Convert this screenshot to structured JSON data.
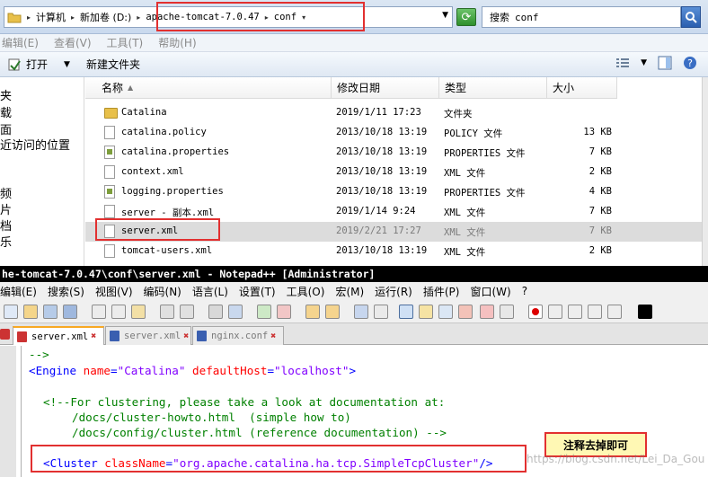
{
  "explorer": {
    "breadcrumbs": [
      "计算机",
      "新加卷 (D:)",
      "apache-tomcat-7.0.47",
      "conf"
    ],
    "search_placeholder": "搜索",
    "search_scope": "conf",
    "menu": [
      "编辑(E)",
      "查看(V)",
      "工具(T)",
      "帮助(H)"
    ],
    "toolbar": {
      "open_label": "打开",
      "new_folder_label": "新建文件夹"
    },
    "nav_items": [
      "夹",
      "载",
      "面",
      "近访问的位置",
      "频",
      "片",
      "档",
      "乐"
    ],
    "columns": {
      "name": "名称",
      "date": "修改日期",
      "type": "类型",
      "size": "大小"
    },
    "files": [
      {
        "name": "Catalina",
        "date": "2019/1/11 17:23",
        "type": "文件夹",
        "size": "",
        "icon": "folder-icon"
      },
      {
        "name": "catalina.policy",
        "date": "2013/10/18 13:19",
        "type": "POLICY 文件",
        "size": "13 KB",
        "icon": "file-icon"
      },
      {
        "name": "catalina.properties",
        "date": "2013/10/18 13:19",
        "type": "PROPERTIES 文件",
        "size": "7 KB",
        "icon": "config-file-icon"
      },
      {
        "name": "context.xml",
        "date": "2013/10/18 13:19",
        "type": "XML 文件",
        "size": "2 KB",
        "icon": "file-icon"
      },
      {
        "name": "logging.properties",
        "date": "2013/10/18 13:19",
        "type": "PROPERTIES 文件",
        "size": "4 KB",
        "icon": "config-file-icon"
      },
      {
        "name": "server - 副本.xml",
        "date": "2019/1/14 9:24",
        "type": "XML 文件",
        "size": "7 KB",
        "icon": "file-icon"
      },
      {
        "name": "server.xml",
        "date": "2019/2/21 17:27",
        "type": "XML 文件",
        "size": "7 KB",
        "icon": "file-icon"
      },
      {
        "name": "tomcat-users.xml",
        "date": "2013/10/18 13:19",
        "type": "XML 文件",
        "size": "2 KB",
        "icon": "file-icon"
      }
    ],
    "selected_file": "server.xml"
  },
  "notepad": {
    "title": "he-tomcat-7.0.47\\conf\\server.xml - Notepad++ [Administrator]",
    "menu": [
      "编辑(E)",
      "搜索(S)",
      "视图(V)",
      "编码(N)",
      "语言(L)",
      "设置(T)",
      "工具(O)",
      "宏(M)",
      "运行(R)",
      "插件(P)",
      "窗口(W)",
      "?"
    ],
    "tabs": [
      {
        "label": "server.xml",
        "active": true
      },
      {
        "label": "server.xml",
        "active": false
      },
      {
        "label": "nginx.conf",
        "active": false
      }
    ],
    "code": {
      "line1": "-->",
      "line2": {
        "tag_open": "<Engine",
        "attr1": "name",
        "val1": "\"Catalina\"",
        "attr2": "defaultHost",
        "val2": "\"localhost\"",
        "close": ">"
      },
      "line3": "<!--For clustering, please take a look at documentation at:",
      "line4": "/docs/cluster-howto.html  (simple how to)",
      "line5": "/docs/config/cluster.html (reference documentation) -->",
      "line6": {
        "tag_open": "<Cluster",
        "attr1": "className",
        "val1": "\"org.apache.catalina.ha.tcp.SimpleTcpCluster\"",
        "close": "/>"
      }
    },
    "annotation": "注释去掉即可",
    "watermark": "https://blog.csdn.net/Lei_Da_Gou"
  },
  "colors": {
    "highlight_box": "#e23030",
    "comment": "#008000",
    "tag": "#0000ff",
    "attribute": "#ff0000",
    "value": "#8000ff"
  }
}
